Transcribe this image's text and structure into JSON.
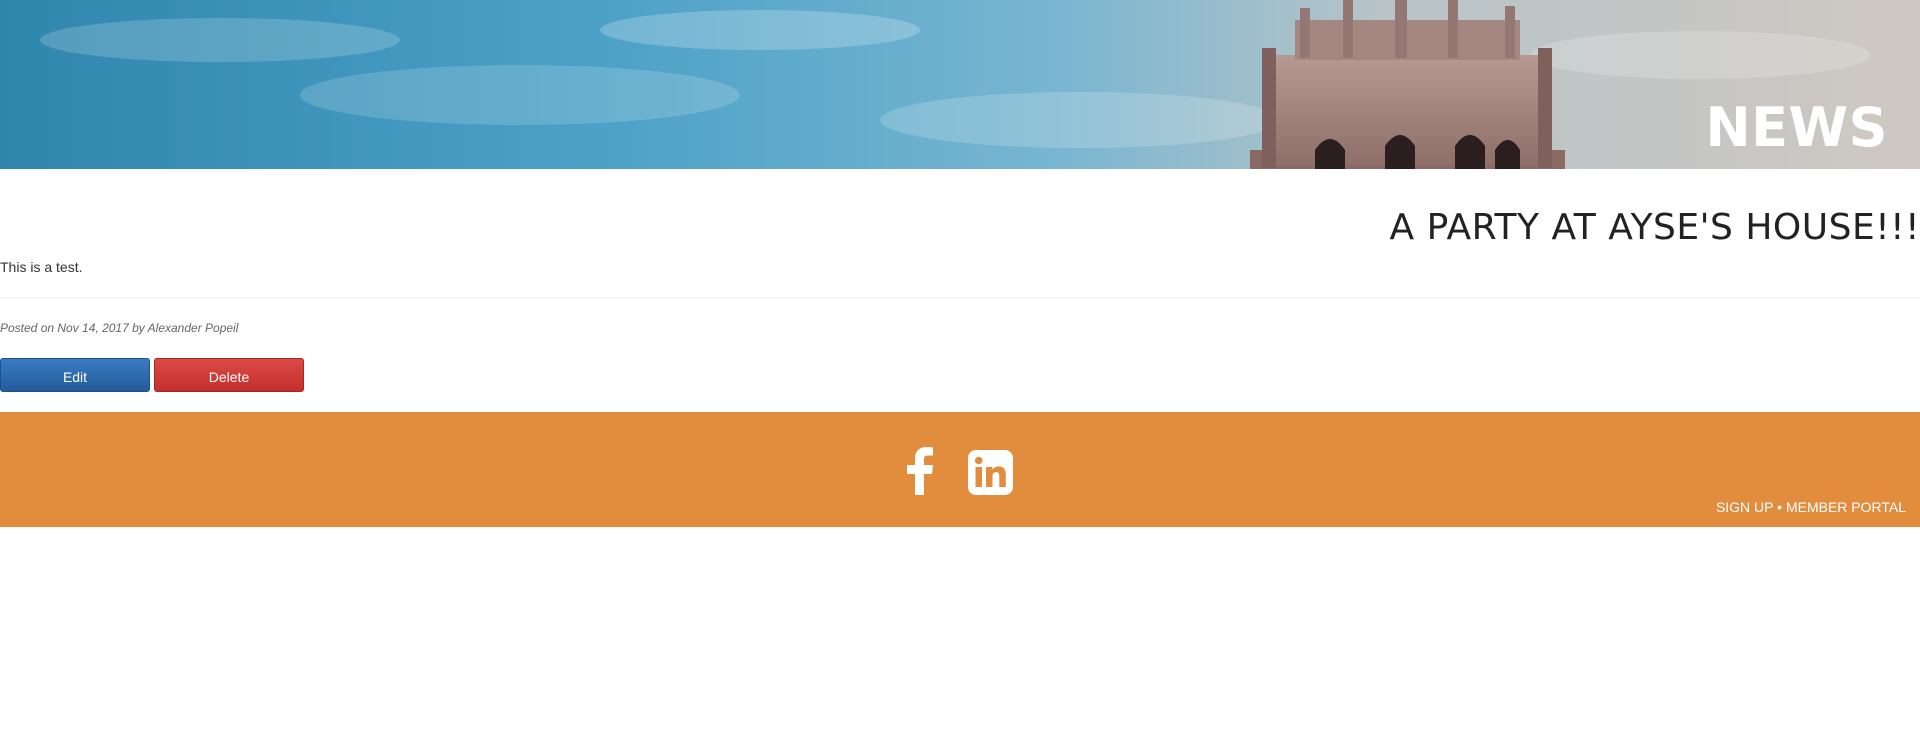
{
  "header": {
    "title": "NEWS"
  },
  "article": {
    "title": "A PARTY AT AYSE'S HOUSE!!!",
    "body": "This is a test.",
    "byline": "Posted on Nov 14, 2017 by Alexander Popeil"
  },
  "actions": {
    "edit_label": "Edit",
    "delete_label": "Delete"
  },
  "colors": {
    "edit_button": "#2c6aab",
    "delete_button": "#cf3b38",
    "footer": "#e28d3d"
  },
  "footer": {
    "icons": [
      "facebook-icon",
      "linkedin-icon"
    ],
    "sign_up_label": "SIGN UP",
    "separator": "•",
    "member_portal_label": "MEMBER PORTAL"
  }
}
